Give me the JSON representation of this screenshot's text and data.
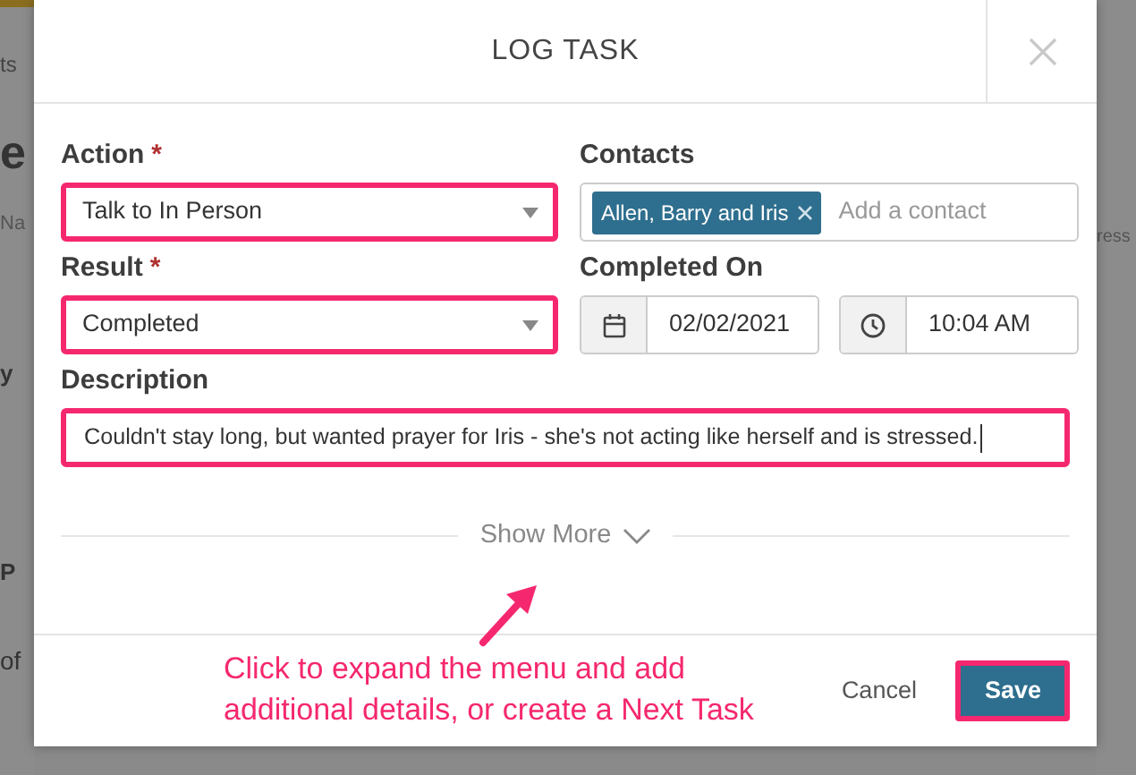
{
  "backdrop": {
    "left_texts": [
      {
        "kind": "menu",
        "text": "ts"
      },
      {
        "kind": "heading",
        "text": "e"
      },
      {
        "kind": "column",
        "text": "Na"
      },
      {
        "kind": "bold",
        "text": "y"
      },
      {
        "kind": "bold",
        "text": "P"
      },
      {
        "kind": "plain",
        "text": "of"
      }
    ],
    "right_texts": [
      {
        "kind": "column",
        "text": "ress"
      }
    ]
  },
  "modal": {
    "title": "LOG TASK",
    "action": {
      "label": "Action",
      "required_mark": "*",
      "value": "Talk to In Person",
      "highlighted": true
    },
    "contacts": {
      "label": "Contacts",
      "tags": [
        {
          "text": "Allen, Barry and Iris"
        }
      ],
      "placeholder": "Add a contact",
      "highlighted": false
    },
    "result": {
      "label": "Result",
      "required_mark": "*",
      "value": "Completed",
      "highlighted": true
    },
    "completed_on": {
      "label": "Completed On",
      "date": "02/02/2021",
      "time": "10:04 AM"
    },
    "description": {
      "label": "Description",
      "value": "Couldn't stay long, but wanted prayer for Iris - she's not acting like herself and is stressed.",
      "focused": true,
      "highlighted": true
    },
    "show_more": {
      "text": "Show More",
      "expanded": false
    },
    "footer": {
      "cancel": "Cancel",
      "save": "Save",
      "save_highlighted": true
    }
  },
  "annotation": {
    "text": "Click to expand the menu and add additional details, or create a Next Task"
  }
}
